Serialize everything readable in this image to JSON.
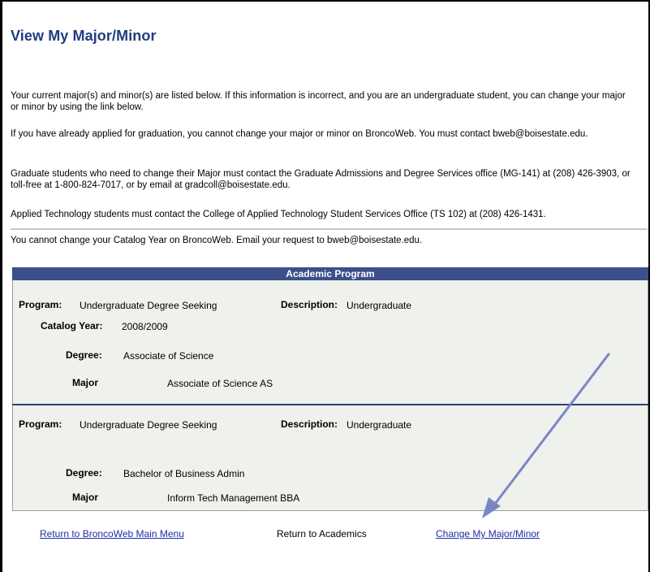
{
  "page_title": "View My Major/Minor",
  "intro": [
    "Your current major(s) and minor(s) are listed below. If this information is incorrect, and you are an undergraduate student, you can change your major or minor by using the link below.",
    "If you have already applied for graduation, you cannot change your major or minor on BroncoWeb. You must contact bweb@boisestate.edu.",
    "Graduate students who need to change their Major must contact the Graduate Admissions and Degree Services office (MG-141) at (208) 426-3903, or toll-free at 1-800-824-7017, or by email at gradcoll@boisestate.edu.",
    "Applied Technology students must contact the College of Applied Technology Student Services Office (TS 102) at (208) 426-1431.",
    "You cannot change your Catalog Year on BroncoWeb. Email your request to bweb@boisestate.edu."
  ],
  "academic_program": {
    "header": "Academic Program",
    "programs": [
      {
        "program_label": "Program:",
        "program": "Undergraduate Degree Seeking",
        "description_label": "Description:",
        "description": "Undergraduate",
        "catalog_year_label": "Catalog Year:",
        "catalog_year": "2008/2009",
        "degree_label": "Degree:",
        "degree": "Associate of Science",
        "major_label": "Major",
        "major": "Associate of Science AS"
      },
      {
        "program_label": "Program:",
        "program": "Undergraduate Degree Seeking",
        "description_label": "Description:",
        "description": "Undergraduate",
        "degree_label": "Degree:",
        "degree": "Bachelor of Business Admin",
        "major_label": "Major",
        "major": "Inform Tech Management BBA"
      }
    ]
  },
  "footer": {
    "return_main_menu": "Return to BroncoWeb Main Menu",
    "return_academics": "Return to Academics",
    "change_major_minor": "Change My Major/Minor"
  },
  "colors": {
    "title": "#1f3d7f",
    "header_bar": "#3c4f8a",
    "panel_bg": "#eef1ec",
    "link": "#1d2ea1",
    "annotation_arrow": "#7a86c4"
  },
  "annotation": {
    "icon": "arrow-icon"
  }
}
